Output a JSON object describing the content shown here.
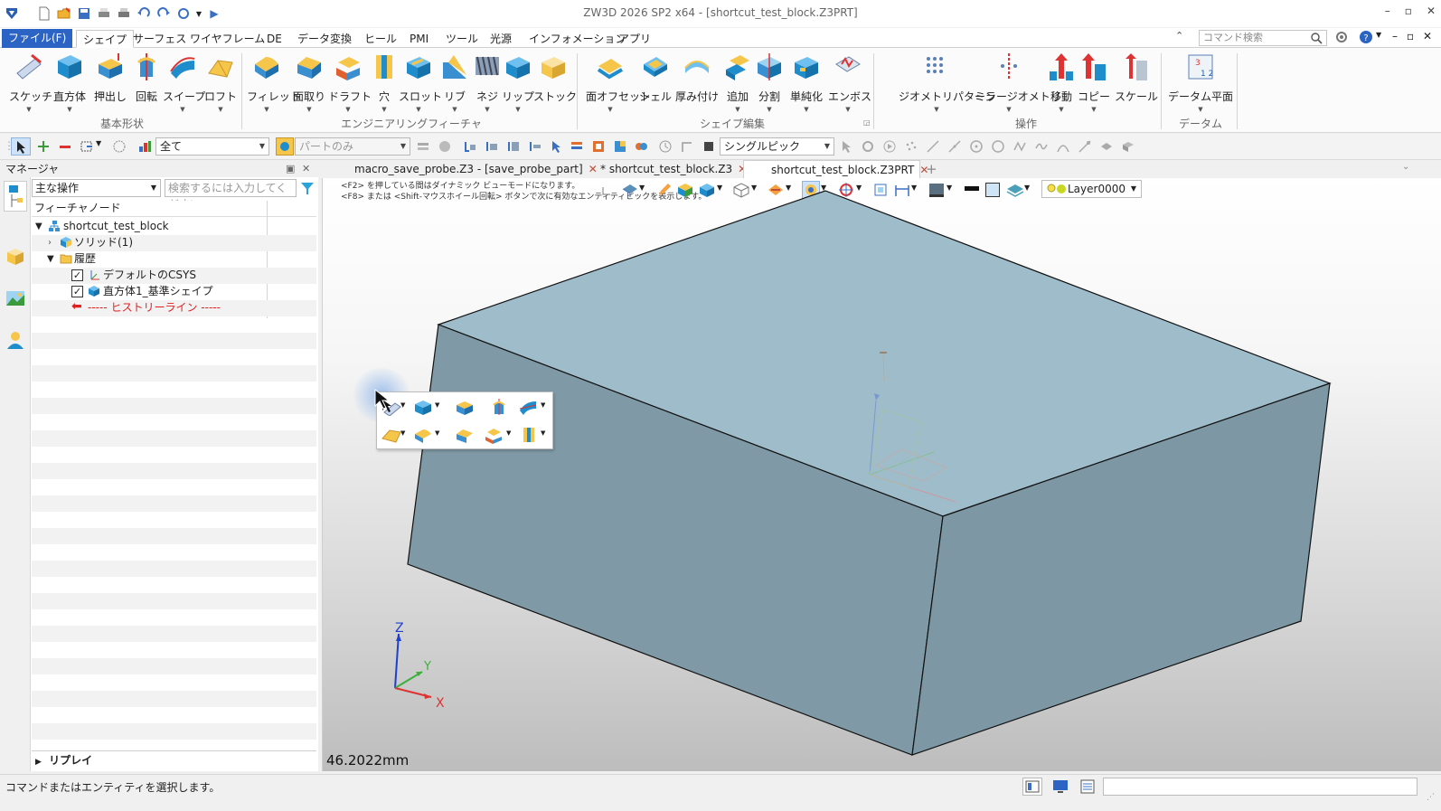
{
  "window": {
    "title": "ZW3D 2026 SP2 x64  - [shortcut_test_block.Z3PRT]",
    "controls": [
      "–",
      "▫",
      "✕"
    ]
  },
  "menu": {
    "tabs": [
      "ファイル(F)",
      "シェイプ",
      "サーフェス",
      "ワイヤフレーム",
      "DE",
      "データ変換",
      "ヒール",
      "PMI",
      "ツール",
      "光源",
      "インフォメーション",
      "アプリ"
    ],
    "active": "シェイプ",
    "command_search_placeholder": "コマンド検索"
  },
  "ribbon": {
    "groups": [
      {
        "label": "基本形状",
        "buttons": [
          "スケッチ",
          "直方体",
          "押出し",
          "回転",
          "スイープ",
          "ロフト"
        ]
      },
      {
        "label": "エンジニアリングフィーチャ",
        "buttons": [
          "フィレット",
          "面取り",
          "ドラフト",
          "穴",
          "スロット",
          "リブ",
          "ネジ",
          "リップ",
          "ストック"
        ]
      },
      {
        "label": "シェイプ編集",
        "buttons": [
          "面オフセット",
          "シェル",
          "厚み付け",
          "追加",
          "分割",
          "単純化",
          "エンボス"
        ]
      },
      {
        "label": "操作",
        "buttons": [
          "ジオメトリパターン",
          "ミラージオメトリ",
          "移動",
          "コピー",
          "スケール"
        ]
      },
      {
        "label": "データム",
        "buttons": [
          "データム平面"
        ]
      }
    ]
  },
  "toolbar2": {
    "filter_value": "全て",
    "scope_value": "パートのみ",
    "pick_mode": "シングルピック"
  },
  "manager": {
    "title": "マネージャ",
    "filter_value": "主な操作",
    "search_placeholder": "検索するには入力してください",
    "column_header": "フィーチャノード",
    "tree": [
      {
        "label": "shortcut_test_block",
        "level": 0,
        "expanded": true,
        "icon": "assembly-icon"
      },
      {
        "label": "ソリッド(1)",
        "level": 1,
        "expanded": false,
        "icon": "solid-icon"
      },
      {
        "label": "履歴",
        "level": 1,
        "expanded": true,
        "icon": "folder-icon"
      },
      {
        "label": "デフォルトのCSYS",
        "level": 2,
        "checked": true,
        "icon": "csys-icon"
      },
      {
        "label": "直方体1_基準シェイプ",
        "level": 2,
        "checked": true,
        "icon": "block-icon"
      },
      {
        "label": "----- ヒストリーライン -----",
        "level": 2,
        "icon": "history-line-icon",
        "color": "#e02020"
      }
    ],
    "replay_label": "リプレイ"
  },
  "doc_tabs": [
    {
      "label": "macro_save_probe.Z3 - [save_probe_part]",
      "active": false
    },
    {
      "label": "* shortcut_test_block.Z3",
      "active": false
    },
    {
      "label": "shortcut_test_block.Z3PRT",
      "active": true
    }
  ],
  "viewport": {
    "hint_line1": "<F2> を押している間はダイナミック ビューモードになります。",
    "hint_line2": "<F8> または <Shift-マウスホイール回転> ボタンで次に有効なエンティティピックを表示します。",
    "layer": "Layer0000",
    "distance": "46.2022mm",
    "axis_labels": {
      "x": "X",
      "y": "Y",
      "z": "Z"
    },
    "colors": {
      "block_top": "#9fbccb",
      "block_left": "#7f9aa6",
      "block_right": "#7d98a4"
    }
  },
  "status": {
    "text": "コマンドまたはエンティティを選択します。"
  }
}
